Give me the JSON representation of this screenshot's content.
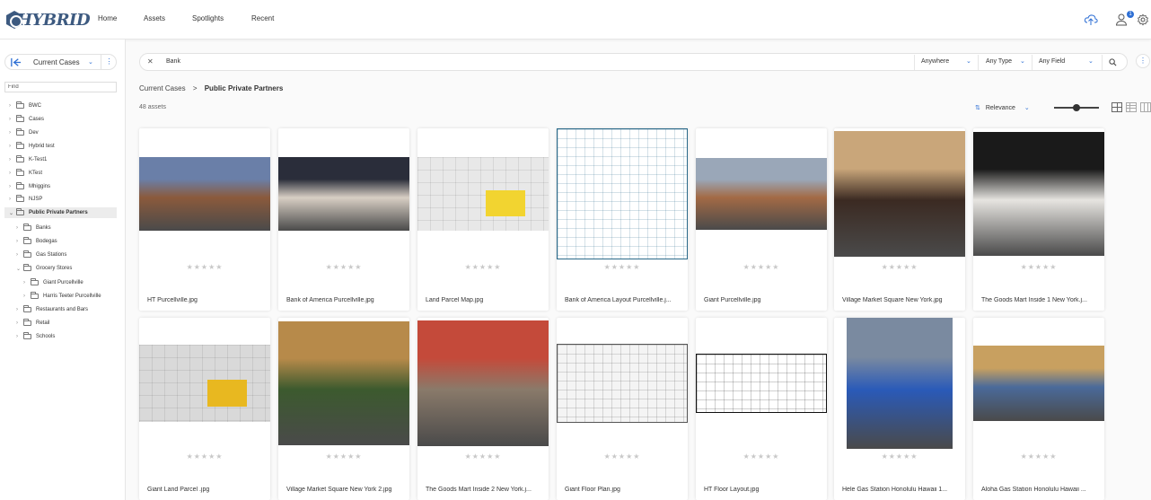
{
  "header": {
    "logo": "HYBRID",
    "nav": [
      "Home",
      "Assets",
      "Spotlights",
      "Recent"
    ],
    "notification_count": "1",
    "icons": [
      "upload-icon",
      "user-icon",
      "gear-icon"
    ]
  },
  "sidebar": {
    "title": "Current Cases",
    "find_placeholder": "Find",
    "tree": [
      {
        "label": "BWC",
        "level": 0,
        "expanded": false,
        "selected": false
      },
      {
        "label": "Cases",
        "level": 0,
        "expanded": false,
        "selected": false
      },
      {
        "label": "Dev",
        "level": 0,
        "expanded": false,
        "selected": false
      },
      {
        "label": "Hybrid test",
        "level": 0,
        "expanded": false,
        "selected": false
      },
      {
        "label": "K-Test1",
        "level": 0,
        "expanded": false,
        "selected": false
      },
      {
        "label": "KTest",
        "level": 0,
        "expanded": false,
        "selected": false
      },
      {
        "label": "Mhiggins",
        "level": 0,
        "expanded": false,
        "selected": false
      },
      {
        "label": "NJSP",
        "level": 0,
        "expanded": false,
        "selected": false
      },
      {
        "label": "Public Private Partners",
        "level": 0,
        "expanded": true,
        "selected": true
      },
      {
        "label": "Banks",
        "level": 1,
        "expanded": false,
        "selected": false
      },
      {
        "label": "Bodegas",
        "level": 1,
        "expanded": false,
        "selected": false
      },
      {
        "label": "Gas Stations",
        "level": 1,
        "expanded": false,
        "selected": false
      },
      {
        "label": "Grocery Stores",
        "level": 1,
        "expanded": true,
        "selected": false
      },
      {
        "label": "Giant Purcellville",
        "level": 2,
        "expanded": false,
        "selected": false
      },
      {
        "label": "Harris Teeter Purcellville",
        "level": 2,
        "expanded": false,
        "selected": false
      },
      {
        "label": "Restaurants and Bars",
        "level": 1,
        "expanded": false,
        "selected": false
      },
      {
        "label": "Retail",
        "level": 1,
        "expanded": false,
        "selected": false
      },
      {
        "label": "Schools",
        "level": 1,
        "expanded": false,
        "selected": false
      }
    ]
  },
  "search": {
    "query": "Bank",
    "scope": "Anywhere",
    "type": "Any Type",
    "field": "Any Field"
  },
  "breadcrumb": {
    "parent": "Current Cases",
    "separator": ">",
    "current": "Public Private Partners"
  },
  "results": {
    "count": "48 assets",
    "sort": "Relevance",
    "zoom": 0.5,
    "rating_stars": "★★★★★"
  },
  "assets": [
    {
      "name": "HT Purcellville.jpg",
      "kind": "photo",
      "colors": [
        "#8b5a3c",
        "#6a7fa8"
      ]
    },
    {
      "name": "Bank of America Purcellville.jpg",
      "kind": "photo",
      "colors": [
        "#d8cfc4",
        "#2a2d3a"
      ]
    },
    {
      "name": "Land Parcel Map.jpg",
      "kind": "map",
      "colors": [
        "#e8e8e8",
        "#f2d430"
      ]
    },
    {
      "name": "Bank of America Layout Purcellville.j...",
      "kind": "plan",
      "colors": [
        "#ffffff",
        "#2b6a8a"
      ]
    },
    {
      "name": "Giant Purcellville.jpg",
      "kind": "photo",
      "colors": [
        "#a36a45",
        "#9aa7b8"
      ]
    },
    {
      "name": "Village Market Square New York.jpg",
      "kind": "photo",
      "colors": [
        "#3b2a22",
        "#c9a67a"
      ]
    },
    {
      "name": "The Goods Mart Inside 1 New York.j...",
      "kind": "photo",
      "colors": [
        "#e6e4e0",
        "#1a1a1a"
      ]
    },
    {
      "name": "Giant Land Parcel .jpg",
      "kind": "map",
      "colors": [
        "#d9d9d9",
        "#e8b820"
      ]
    },
    {
      "name": "Village Market Square New York 2.jpg",
      "kind": "photo",
      "colors": [
        "#3c5a2e",
        "#b78a4a"
      ]
    },
    {
      "name": "The Goods Mart Inside 2 New York.j...",
      "kind": "photo",
      "colors": [
        "#8a7a6a",
        "#c44a3a"
      ]
    },
    {
      "name": "Giant Floor Plan.jpg",
      "kind": "plan",
      "colors": [
        "#f4f4f4",
        "#555555"
      ]
    },
    {
      "name": "HT Floor Layout.jpg",
      "kind": "plan",
      "colors": [
        "#ffffff",
        "#111111"
      ]
    },
    {
      "name": "Hele Gas Station Honolulu Hawaii 1...",
      "kind": "photo",
      "colors": [
        "#2a5ab8",
        "#7a8aa0"
      ]
    },
    {
      "name": "Aloha Gas Station Honolulu Hawaii ...",
      "kind": "photo",
      "colors": [
        "#4a6a9a",
        "#c8a060"
      ]
    }
  ]
}
